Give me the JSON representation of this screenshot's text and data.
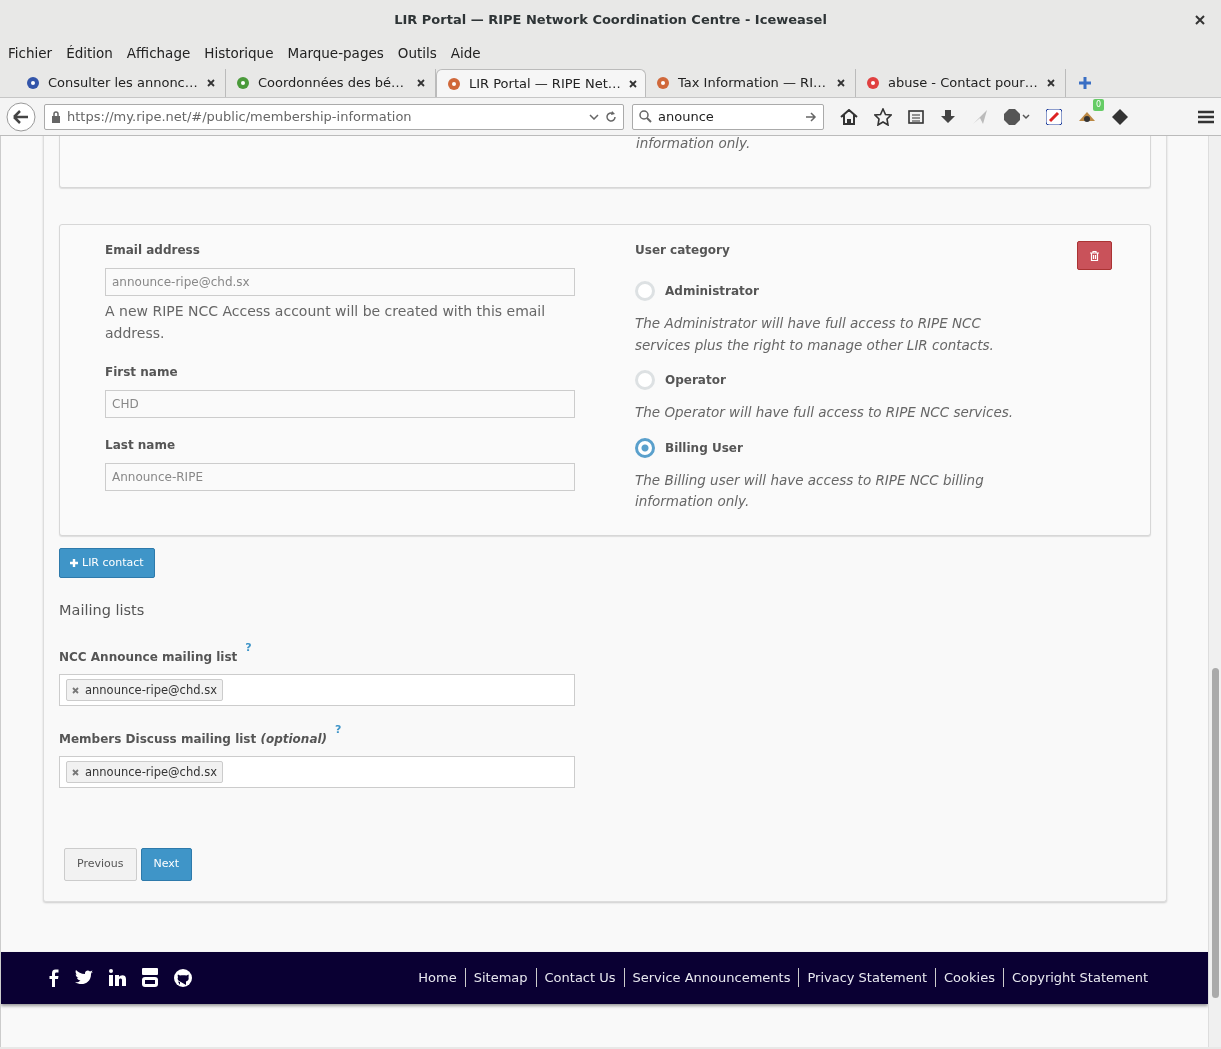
{
  "window": {
    "title": "LIR Portal — RIPE Network Coordination Centre - Iceweasel"
  },
  "menu_bar": [
    "Fichier",
    "Édition",
    "Affichage",
    "Historique",
    "Marque-pages",
    "Outils",
    "Aide"
  ],
  "tabs": [
    {
      "label": "Consulter les annonc…",
      "selected": false,
      "color": "#3355aa"
    },
    {
      "label": "Coordonnées des bé…",
      "selected": false,
      "color": "#4a9a3a"
    },
    {
      "label": "LIR Portal — RIPE Net…",
      "selected": true,
      "color": "#d0683a"
    },
    {
      "label": "Tax Information — RI…",
      "selected": false,
      "color": "#d0683a"
    },
    {
      "label": "abuse - Contact pour…",
      "selected": false,
      "color": "#e04040"
    }
  ],
  "toolbar": {
    "url": "https://my.ripe.net/#/public/membership-information",
    "search": "anounce",
    "badge": "0"
  },
  "previous_card": {
    "text": "information only."
  },
  "contact": {
    "fields": [
      {
        "label": "Email address",
        "value": "announce-ripe@chd.sx",
        "help": "A new RIPE NCC Access account will be created with this email address."
      },
      {
        "label": "First name",
        "value": "CHD"
      },
      {
        "label": "Last name",
        "value": "Announce-RIPE"
      }
    ],
    "category_label": "User category",
    "options": [
      {
        "label": "Administrator",
        "description": "The Administrator will have full access to RIPE NCC services plus the right to manage other LIR contacts.",
        "selected": false
      },
      {
        "label": "Operator",
        "description": "The Operator will have full access to RIPE NCC services.",
        "selected": false
      },
      {
        "label": "Billing User",
        "description": "The Billing user will have access to RIPE NCC billing information only.",
        "selected": true
      }
    ]
  },
  "add_contact_button": "LIR contact",
  "mailing_lists": {
    "heading": "Mailing lists",
    "lists": [
      {
        "label": "NCC Announce mailing list",
        "help": "?",
        "tags": [
          "announce-ripe@chd.sx"
        ]
      },
      {
        "label": "Members Discuss mailing list *(optional)*",
        "help": "?",
        "tags": [
          "announce-ripe@chd.sx"
        ]
      }
    ]
  },
  "buttons": [
    {
      "label": "Previous",
      "kind": "secondary"
    },
    {
      "label": "Next",
      "kind": "primary"
    }
  ],
  "footer": {
    "links": [
      "Home",
      "Sitemap",
      "Contact Us",
      "Service Announcements",
      "Privacy Statement",
      "Cookies",
      "Copyright Statement"
    ]
  }
}
